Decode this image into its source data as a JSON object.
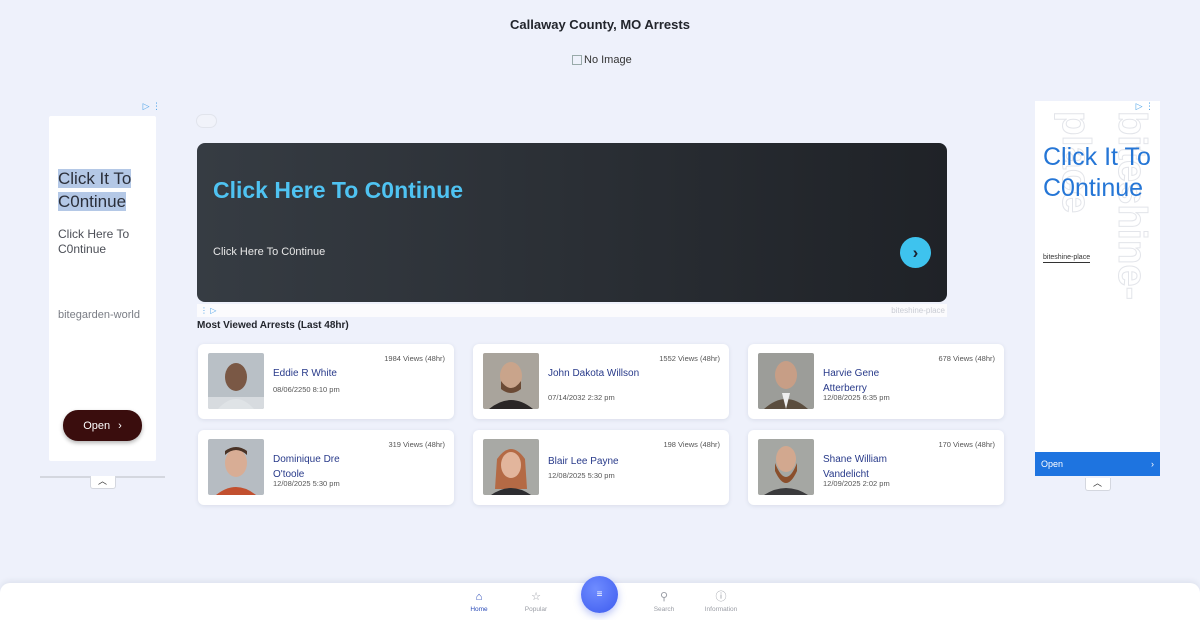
{
  "page": {
    "title": "Callaway County, MO Arrests",
    "broken_image_alt": "No Image"
  },
  "left_ad": {
    "headline": "Click It To C0ntinue",
    "subtext": "Click Here To C0ntinue",
    "brand": "bitegarden-world",
    "button_label": "Open"
  },
  "right_ad": {
    "headline": "Click It To C0ntinue",
    "watermark": "biteshine-place",
    "link": "biteshine-place",
    "button_label": "Open"
  },
  "banner": {
    "title": "Click Here To C0ntinue",
    "subtitle": "Click Here To C0ntinue",
    "source": "biteshine-place"
  },
  "section": {
    "title": "Most Viewed Arrests (Last 48hr)"
  },
  "arrests": [
    {
      "name": "Eddie R White",
      "date": "08/06/2250 8:10 pm",
      "views": "1984 Views (48hr)"
    },
    {
      "name": "John Dakota Willson",
      "date": "07/14/2032 2:32 pm",
      "views": "1552 Views (48hr)"
    },
    {
      "name": "Harvie Gene Atterberry",
      "date": "12/08/2025 6:35 pm",
      "views": "678 Views (48hr)"
    },
    {
      "name": "Dominique Dre O'toole",
      "date": "12/08/2025 5:30 pm",
      "views": "319 Views (48hr)"
    },
    {
      "name": "Blair Lee Payne",
      "date": "12/08/2025 5:30 pm",
      "views": "198 Views (48hr)"
    },
    {
      "name": "Shane William Vandelicht",
      "date": "12/09/2025 2:02 pm",
      "views": "170 Views (48hr)"
    }
  ],
  "nav": {
    "home": "Home",
    "popular": "Popular",
    "search": "Search",
    "information": "Information"
  },
  "colors": {
    "accent": "#2b4bb8",
    "banner_title": "#4fc3f2",
    "fab": "#3d5bef"
  }
}
